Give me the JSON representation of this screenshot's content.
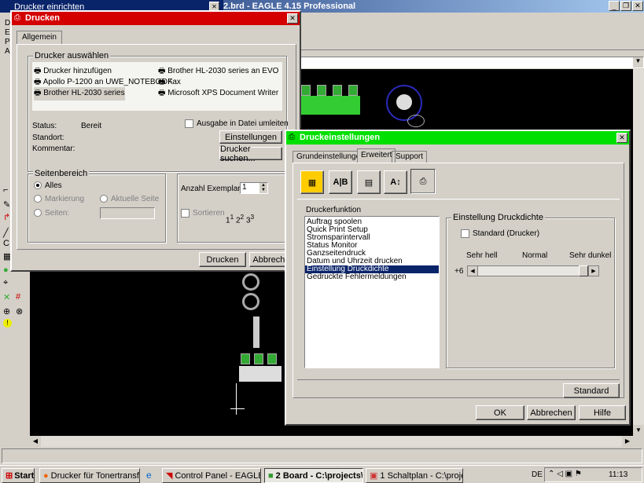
{
  "eagle": {
    "title": "2.brd - EAGLE 4.15 Professional",
    "menu_left_letters": [
      "D",
      "E",
      "P",
      "A"
    ],
    "status_text": ""
  },
  "back_window": {
    "title": "Drucker einrichten"
  },
  "print_dialog": {
    "title": "Drucken",
    "tab": "Allgemein",
    "select_printer_label": "Drucker auswählen",
    "printers_col1": [
      "Drucker hinzufügen",
      "Apollo P-1200 an UWE_NOTEBOOK",
      "Brother HL-2030 series"
    ],
    "printers_col2": [
      "Brother HL-2030 series an EVO",
      "Fax",
      "Microsoft XPS Document Writer"
    ],
    "status_label": "Status:",
    "status_value": "Bereit",
    "location_label": "Standort:",
    "comment_label": "Kommentar:",
    "print_to_file_label": "Ausgabe in Datei umleiten",
    "settings_button": "Einstellungen",
    "find_printer_button": "Drucker suchen...",
    "page_range_label": "Seitenbereich",
    "range_all": "Alles",
    "range_selection": "Markierung",
    "range_current": "Aktuelle Seite",
    "range_pages": "Seiten:",
    "copies_label": "Anzahl Exemplare:",
    "copies_value": "1",
    "collate_label": "Sortieren",
    "print_button": "Drucken",
    "cancel_button": "Abbrechen"
  },
  "settings_dialog": {
    "title": "Druckeinstellungen",
    "tabs": [
      "Grundeinstellungen",
      "Erweitert",
      "Support"
    ],
    "functions_label": "Druckerfunktion",
    "functions": [
      "Auftrag spoolen",
      "Quick Print Setup",
      "Stromsparintervall",
      "Status Monitor",
      "Ganzseitendruck",
      "Datum und Uhrzeit drucken",
      "Einstellung Druckdichte",
      "Gedruckte Fehlermeldungen"
    ],
    "selected_function_index": 6,
    "density_group_label": "Einstellung Druckdichte",
    "standard_printer_label": "Standard (Drucker)",
    "scale_light": "Sehr hell",
    "scale_normal": "Normal",
    "scale_dark": "Sehr dunkel",
    "density_value": "+6",
    "standard_button": "Standard",
    "ok_button": "OK",
    "cancel_button": "Abbrechen",
    "help_button": "Hilfe"
  },
  "taskbar": {
    "start": "Start",
    "tasks": [
      "Drucker für Tonertransfe...",
      "Control Panel - EAGLE 4....",
      "2 Board - C:\\projects\\...",
      "1 Schaltplan - C:\\project..."
    ],
    "active_task_index": 2,
    "language": "DE",
    "clock": "11:13"
  }
}
